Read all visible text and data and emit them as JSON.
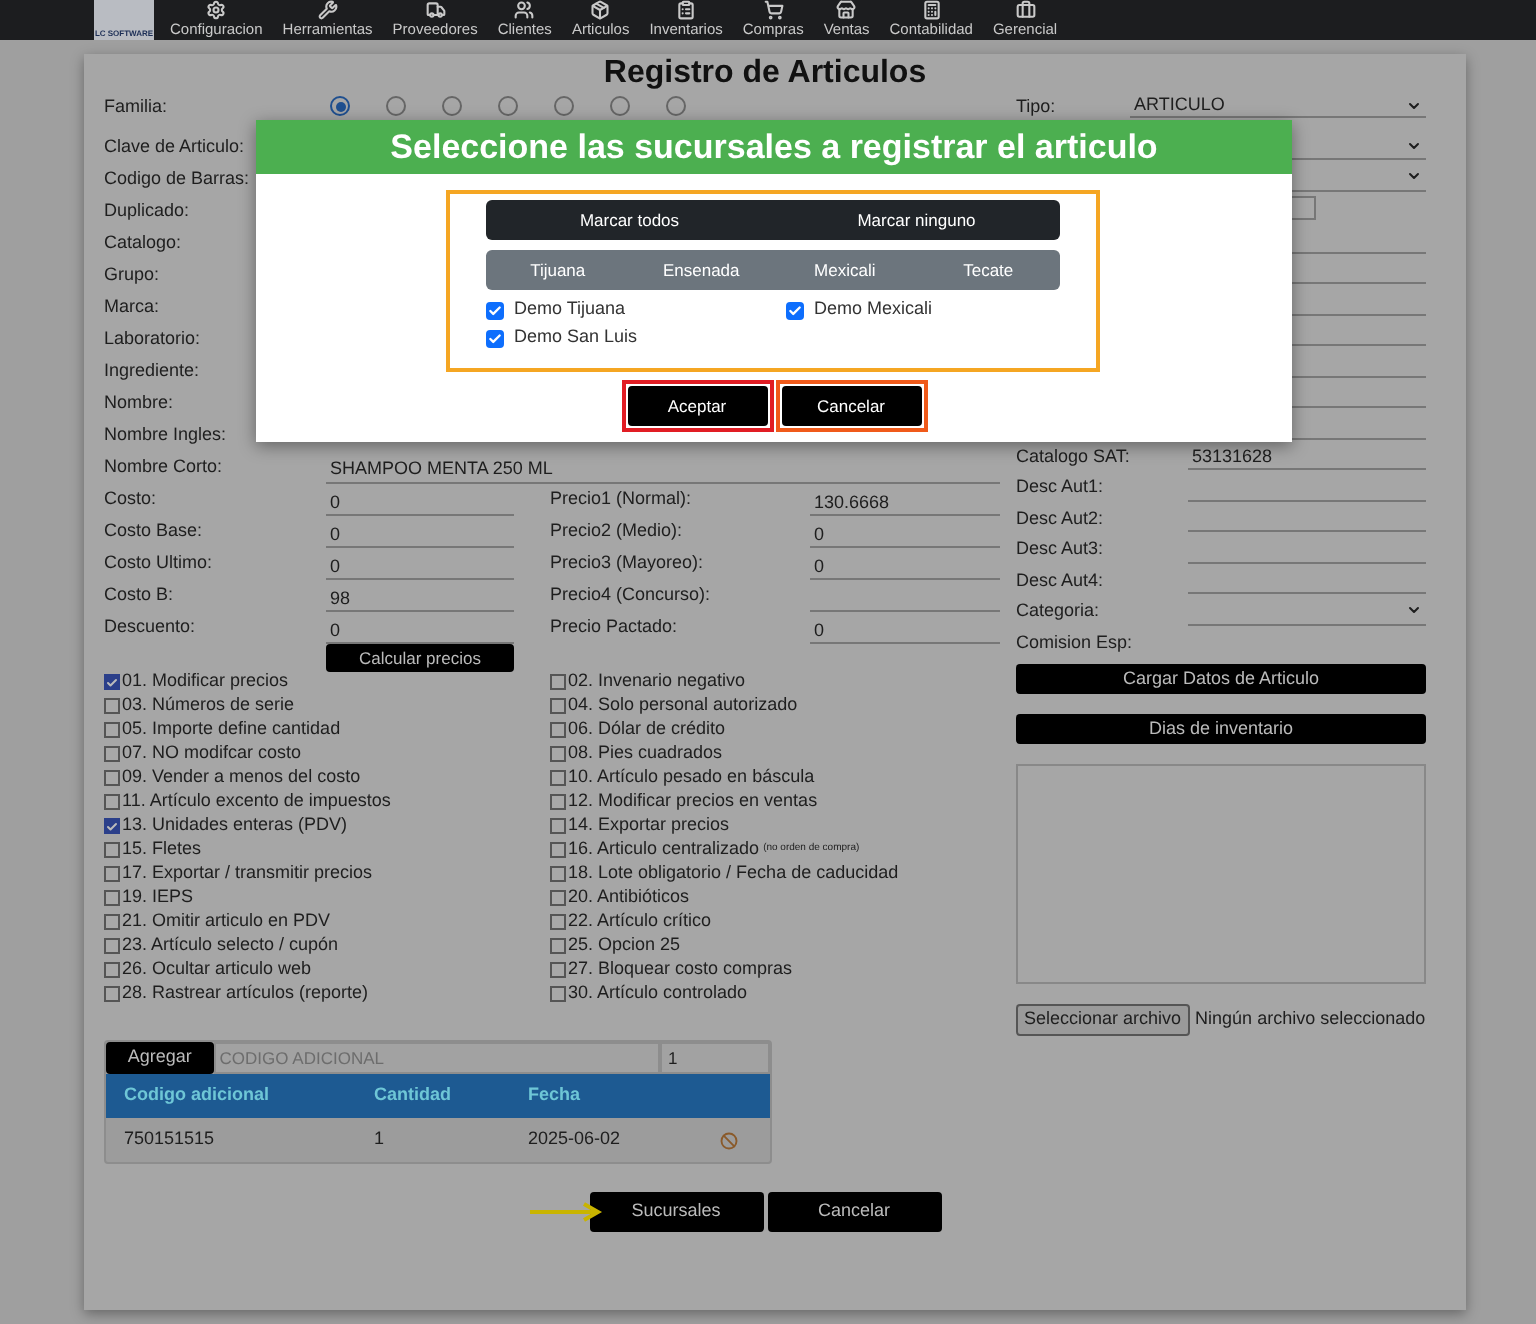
{
  "nav": {
    "logo": "LC SOFTWARE",
    "items": [
      "Configuracion",
      "Herramientas",
      "Proveedores",
      "Clientes",
      "Articulos",
      "Inventarios",
      "Compras",
      "Ventas",
      "Contabilidad",
      "Gerencial"
    ]
  },
  "title": "Registro de Articulos",
  "familia": {
    "label": "Familia:",
    "radios": [
      {
        "selected": true
      },
      {
        "selected": false
      },
      {
        "selected": false
      },
      {
        "selected": false
      },
      {
        "selected": false
      },
      {
        "selected": false
      },
      {
        "selected": false
      }
    ]
  },
  "left_fields": [
    {
      "label": "Clave de Articulo:"
    },
    {
      "label": "Codigo de Barras:"
    },
    {
      "label": "Duplicado:"
    },
    {
      "label": "Catalogo:"
    },
    {
      "label": "Grupo:"
    },
    {
      "label": "Marca:"
    },
    {
      "label": "Laboratorio:"
    },
    {
      "label": "Ingrediente:"
    },
    {
      "label": "Nombre:"
    },
    {
      "label": "Nombre Ingles:"
    },
    {
      "label": "Nombre Corto:",
      "value": "SHAMPOO MENTA 250 ML"
    }
  ],
  "price_rows": [
    {
      "label": "Costo:",
      "value": "0",
      "label2": "Precio1 (Normal):",
      "value2": "130.6668"
    },
    {
      "label": "Costo Base:",
      "value": "0",
      "label2": "Precio2 (Medio):",
      "value2": "0"
    },
    {
      "label": "Costo Ultimo:",
      "value": "0",
      "label2": "Precio3 (Mayoreo):",
      "value2": "0"
    },
    {
      "label": "Costo B:",
      "value": "98",
      "label2": "Precio4 (Concurso):"
    },
    {
      "label": "Descuento:",
      "value": "0",
      "label2": "Precio Pactado:",
      "value2": "0"
    }
  ],
  "calc_button": "Calcular precios",
  "right_fields": [
    {
      "kind": "select",
      "label": "Tipo:",
      "value": "ARTICULO"
    },
    {
      "kind": "select"
    },
    {
      "kind": "select"
    },
    {
      "kind": "box"
    },
    {
      "kind": "line"
    },
    {
      "kind": "line"
    },
    {
      "kind": "line"
    },
    {
      "kind": "line"
    },
    {
      "kind": "line"
    },
    {
      "kind": "line"
    },
    {
      "kind": "line"
    },
    {
      "kind": "line",
      "label": "Catalogo SAT:",
      "value": "53131628"
    },
    {
      "kind": "line",
      "label": "Desc Aut1:"
    },
    {
      "kind": "line",
      "label": "Desc Aut2:"
    },
    {
      "kind": "line",
      "label": "Desc Aut3:"
    },
    {
      "kind": "line",
      "label": "Desc Aut4:"
    },
    {
      "kind": "select",
      "label": "Categoria:"
    },
    {
      "kind": "label",
      "label": "Comision Esp:"
    }
  ],
  "right_buttons": [
    "Cargar Datos de Articulo",
    "Dias de inventario"
  ],
  "file": {
    "button": "Seleccionar archivo",
    "status": "Ningún archivo seleccionado"
  },
  "options": [
    {
      "label": "01. Modificar precios",
      "checked": true
    },
    {
      "label": "02. Invenario negativo",
      "checked": false
    },
    {
      "label": "03. Números de serie",
      "checked": false
    },
    {
      "label": "04. Solo personal autorizado",
      "checked": false
    },
    {
      "label": "05. Importe define cantidad",
      "checked": false
    },
    {
      "label": "06. Dólar de crédito",
      "checked": false
    },
    {
      "label": "07. NO modifcar costo",
      "checked": false
    },
    {
      "label": "08. Pies cuadrados",
      "checked": false
    },
    {
      "label": "09. Vender a menos del costo",
      "checked": false
    },
    {
      "label": "10. Artículo pesado en báscula",
      "checked": false
    },
    {
      "label": "11. Artículo excento de impuestos",
      "checked": false
    },
    {
      "label": "12. Modificar precios en ventas",
      "checked": false
    },
    {
      "label": "13. Unidades enteras (PDV)",
      "checked": true
    },
    {
      "label": "14. Exportar precios",
      "checked": false
    },
    {
      "label": "15. Fletes",
      "checked": false
    },
    {
      "label": "16. Articulo centralizado",
      "note": "(no orden de compra)",
      "checked": false
    },
    {
      "label": "17. Exportar / transmitir precios",
      "checked": false
    },
    {
      "label": "18. Lote obligatorio / Fecha de caducidad",
      "checked": false
    },
    {
      "label": "19. IEPS",
      "checked": false
    },
    {
      "label": "20. Antibióticos",
      "checked": false
    },
    {
      "label": "21. Omitir articulo en PDV",
      "checked": false
    },
    {
      "label": "22. Artículo crítico",
      "checked": false
    },
    {
      "label": "23. Artículo selecto / cupón",
      "checked": false
    },
    {
      "label": "25. Opcion 25",
      "checked": false
    },
    {
      "label": "26. Ocultar articulo web",
      "checked": false
    },
    {
      "label": "27. Bloquear costo compras",
      "checked": false
    },
    {
      "label": "28. Rastrear artículos (reporte)",
      "checked": false
    },
    {
      "label": "30. Artículo controlado",
      "checked": false
    }
  ],
  "codes": {
    "add_button": "Agregar",
    "code_placeholder": "CODIGO ADICIONAL",
    "qty_value": "1",
    "columns": [
      "Codigo adicional",
      "Cantidad",
      "Fecha"
    ],
    "rows": [
      [
        "750151515",
        "1",
        "2025-06-02"
      ]
    ]
  },
  "bottom_buttons": [
    "Sucursales",
    "Cancelar"
  ],
  "modal": {
    "title": "Seleccione las sucursales a registrar el articulo",
    "actions": [
      "Marcar todos",
      "Marcar ninguno"
    ],
    "regions": [
      "Tijuana",
      "Ensenada",
      "Mexicali",
      "Tecate"
    ],
    "branches": [
      {
        "label": "Demo Tijuana",
        "checked": true
      },
      {
        "label": "Demo Mexicali",
        "checked": true
      },
      {
        "label": "Demo San Luis",
        "checked": true
      }
    ],
    "buttons": [
      "Aceptar",
      "Cancelar"
    ]
  }
}
